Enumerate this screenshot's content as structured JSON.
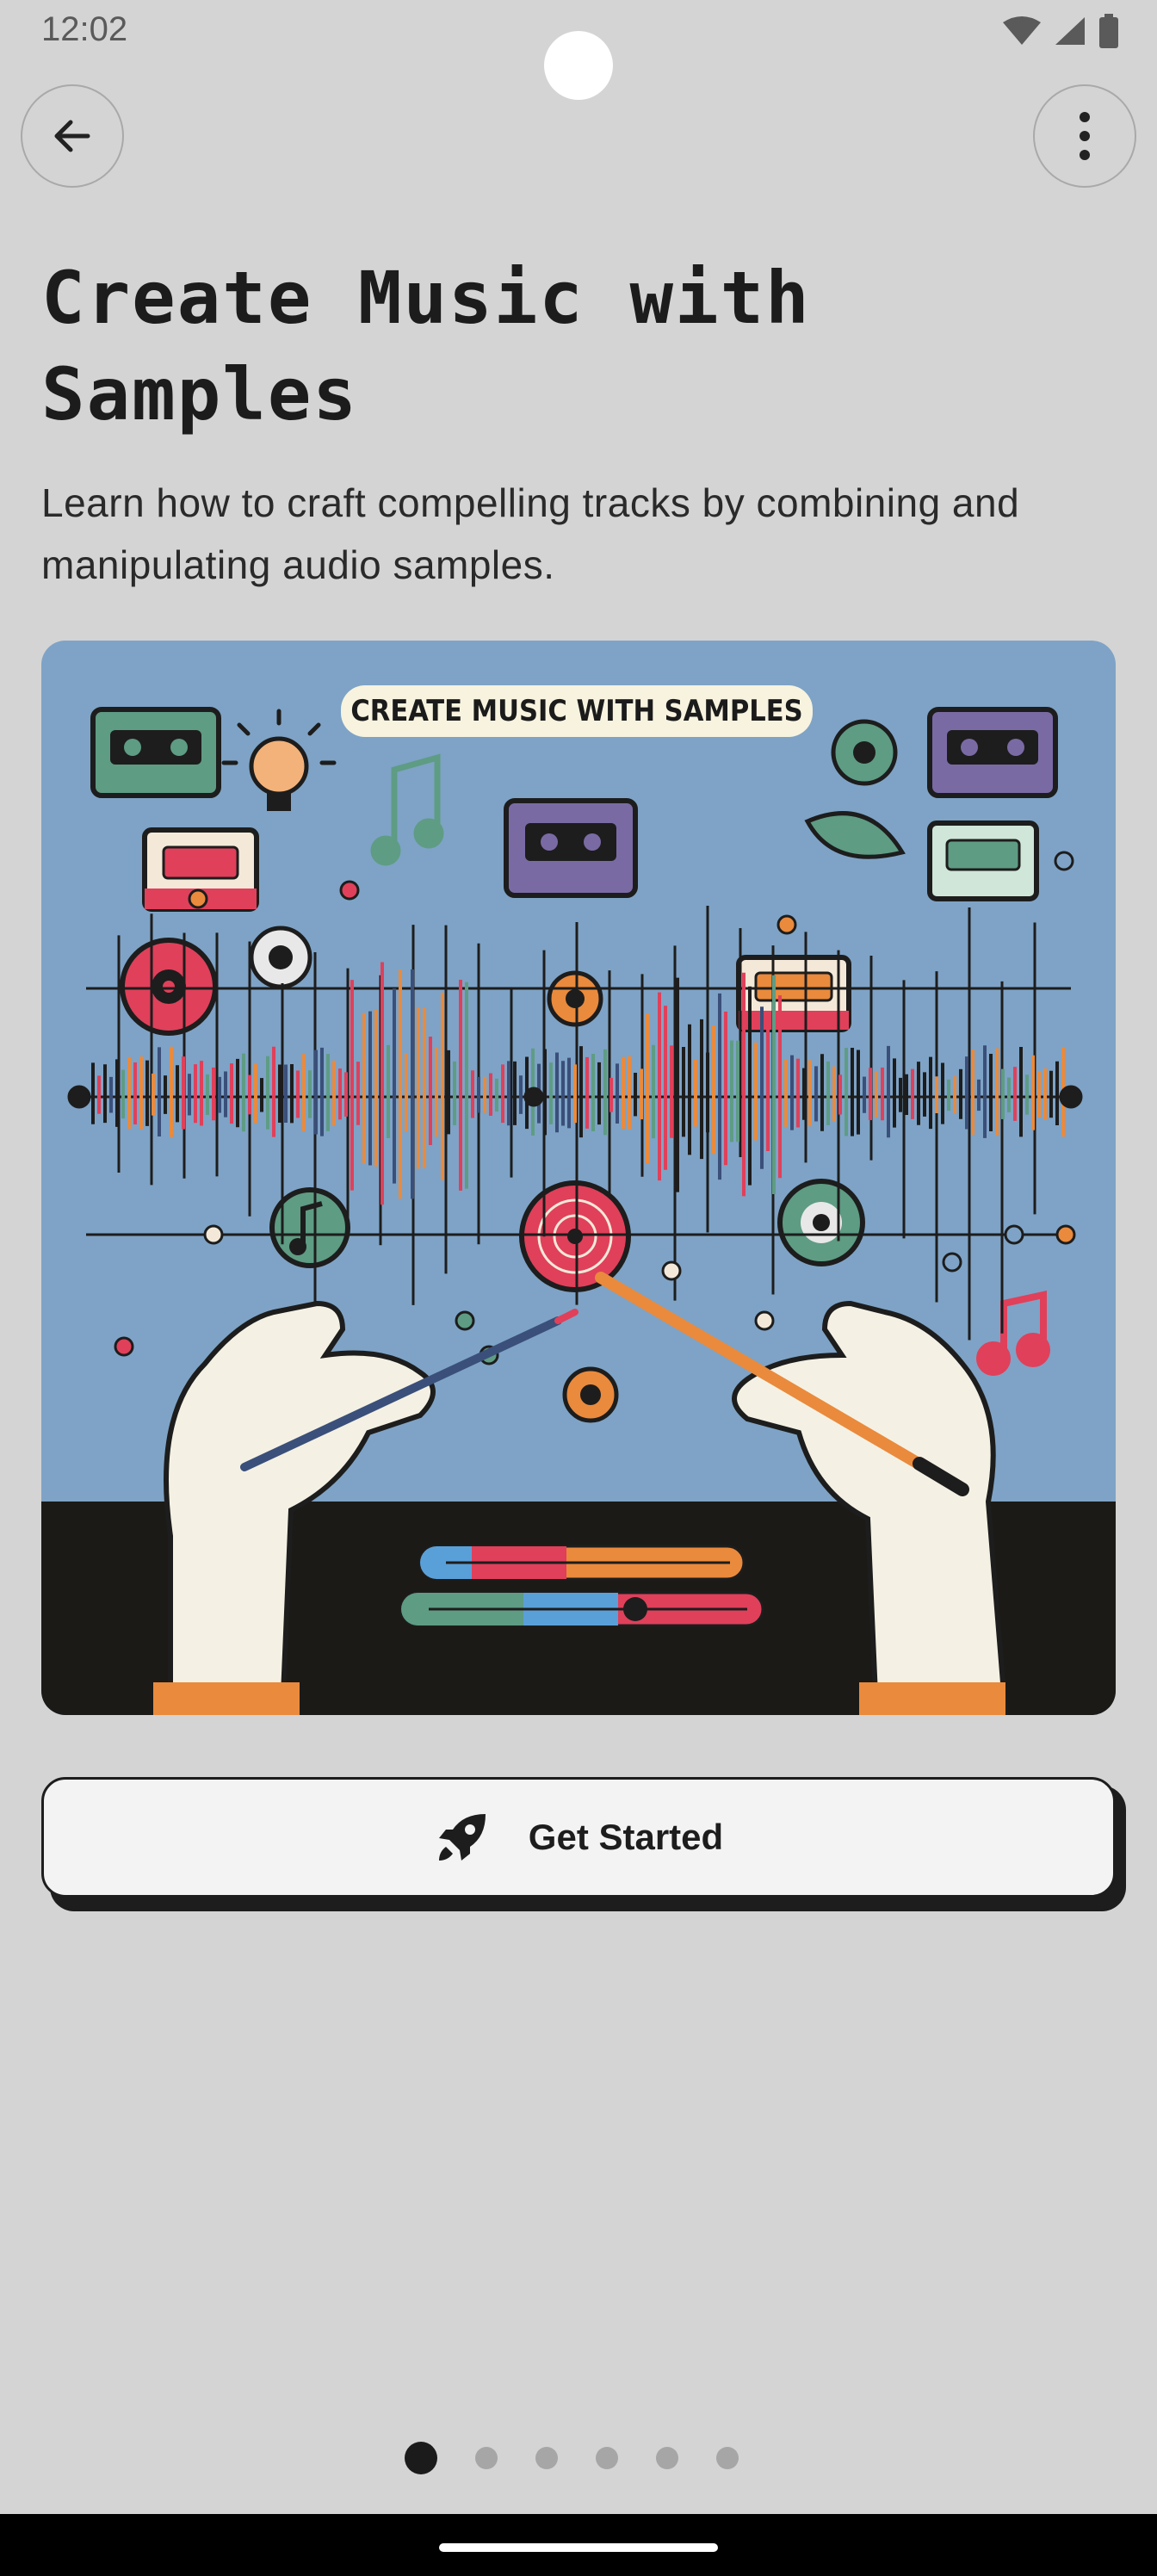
{
  "status_bar": {
    "time": "12:02",
    "icons": [
      "wifi-icon",
      "signal-icon",
      "battery-icon"
    ]
  },
  "toolbar": {
    "back_icon": "arrow-left-icon",
    "more_icon": "more-vertical-icon"
  },
  "content": {
    "title": "Create Music with Samples",
    "subtitle": "Learn how to craft compelling tracks by combining and manipulating audio samples.",
    "hero_image": {
      "banner_text": "CREATE MUSIC WITH SAMPLES"
    }
  },
  "cta": {
    "label": "Get Started",
    "icon": "rocket-icon"
  },
  "pager": {
    "total": 6,
    "active_index": 0
  },
  "colors": {
    "background": "#d4d4d4",
    "hero_sky": "#7ea3c6",
    "accent_red": "#e0405a",
    "accent_orange": "#ea8a3c",
    "accent_green": "#5e9c84",
    "accent_purple": "#7a6aa4"
  }
}
